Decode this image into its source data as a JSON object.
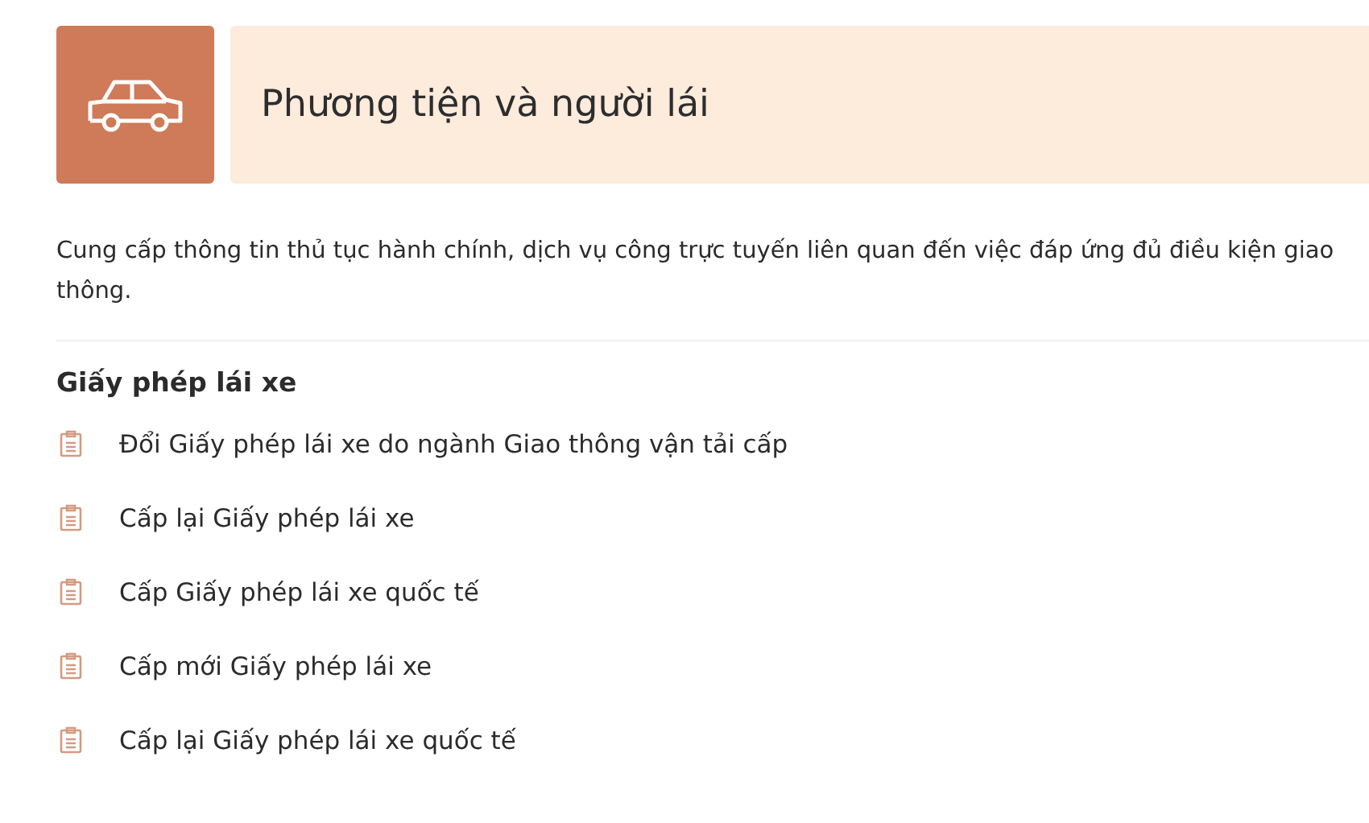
{
  "header": {
    "title": "Phương tiện và người lái"
  },
  "description": "Cung cấp thông tin thủ tục hành chính, dịch vụ công trực tuyến liên quan đến việc đáp ứng đủ điều kiện giao thông.",
  "section": {
    "title": "Giấy phép lái xe",
    "items": [
      {
        "label": "Đổi Giấy phép lái xe do ngành Giao thông vận tải cấp"
      },
      {
        "label": "Cấp lại Giấy phép lái xe"
      },
      {
        "label": "Cấp Giấy phép lái xe quốc tế"
      },
      {
        "label": "Cấp mới Giấy phép lái xe"
      },
      {
        "label": "Cấp lại Giấy phép lái xe quốc tế"
      }
    ]
  }
}
